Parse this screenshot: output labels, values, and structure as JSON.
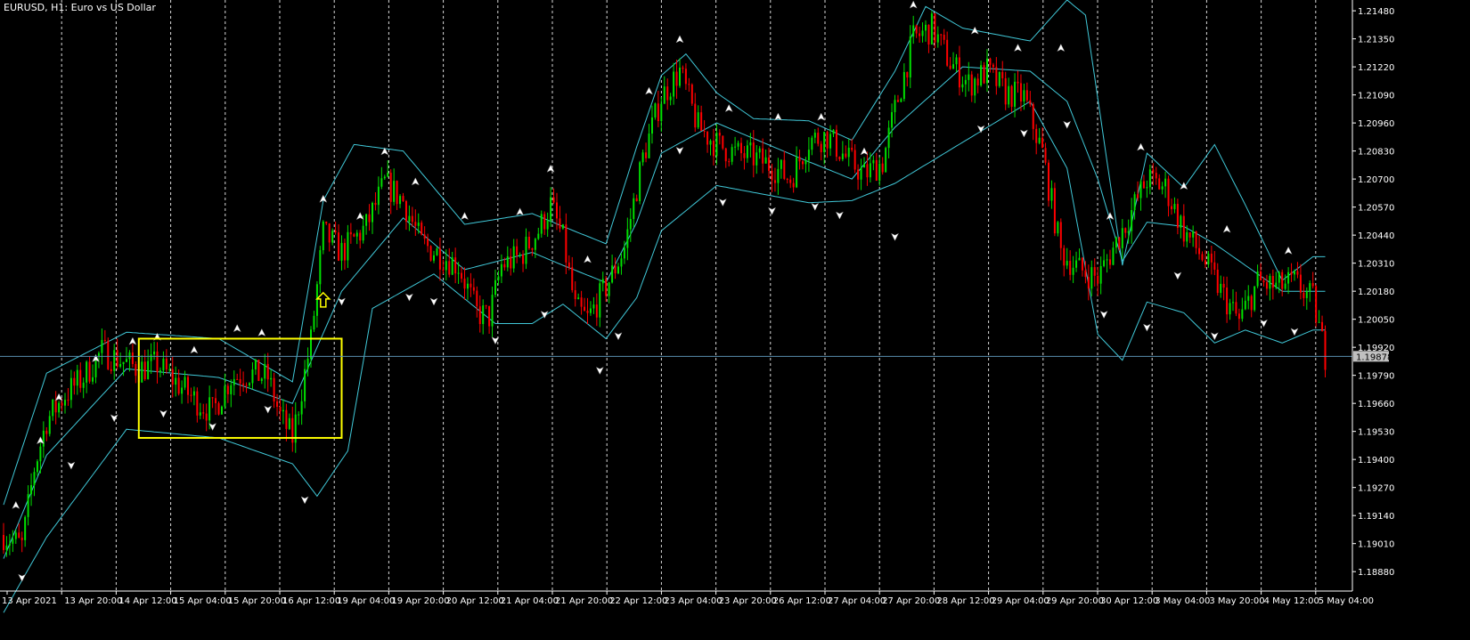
{
  "window": {
    "title": "EURUSD, H1:  Euro vs US Dollar"
  },
  "colors": {
    "background": "#000000",
    "bull": "#00e000",
    "bear": "#ff0000",
    "bands": "#40c8d8",
    "grid": "#ffffff",
    "axis": "#ffffff",
    "price_line": "#5a8fb0",
    "price_tag": "#c0c0c0",
    "annotation": "#ffff00",
    "fractal": "#ffffff"
  },
  "chart_data": {
    "type": "candlestick",
    "symbol": "EURUSD",
    "timeframe": "H1",
    "description": "Euro vs US Dollar",
    "ylim": [
      1.1879,
      1.2153
    ],
    "y_ticks": [
      "1.21480",
      "1.21350",
      "1.21220",
      "1.21090",
      "1.20960",
      "1.20830",
      "1.20700",
      "1.20570",
      "1.20440",
      "1.20310",
      "1.20180",
      "1.20050",
      "1.19920",
      "1.19790",
      "1.19660",
      "1.19530",
      "1.19400",
      "1.19270",
      "1.19140",
      "1.19010",
      "1.18880"
    ],
    "current_price": "1.19878",
    "x_ticks": [
      "13 Apr 2021",
      "13 Apr 20:00",
      "14 Apr 12:00",
      "15 Apr 04:00",
      "15 Apr 20:00",
      "16 Apr 12:00",
      "19 Apr 04:00",
      "19 Apr 20:00",
      "20 Apr 12:00",
      "21 Apr 04:00",
      "21 Apr 20:00",
      "22 Apr 12:00",
      "23 Apr 04:00",
      "23 Apr 20:00",
      "26 Apr 12:00",
      "27 Apr 04:00",
      "27 Apr 20:00",
      "28 Apr 12:00",
      "29 Apr 04:00",
      "29 Apr 20:00",
      "30 Apr 12:00",
      "3 May 04:00",
      "3 May 20:00",
      "4 May 12:00",
      "5 May 04:00"
    ],
    "grid": "vertical-dashed",
    "indicators": [
      "Bollinger Bands",
      "Fractals"
    ],
    "close_path": [
      [
        0,
        1.1905
      ],
      [
        6,
        1.19
      ],
      [
        10,
        1.1936
      ],
      [
        14,
        1.1958
      ],
      [
        20,
        1.197
      ],
      [
        26,
        1.1978
      ],
      [
        32,
        1.199
      ],
      [
        38,
        1.1986
      ],
      [
        44,
        1.1982
      ],
      [
        50,
        1.1984
      ],
      [
        56,
        1.1976
      ],
      [
        62,
        1.1968
      ],
      [
        68,
        1.1962
      ],
      [
        74,
        1.1978
      ],
      [
        80,
        1.198
      ],
      [
        86,
        1.1978
      ],
      [
        90,
        1.196
      ],
      [
        94,
        1.195
      ],
      [
        100,
        1.1995
      ],
      [
        104,
        1.2045
      ],
      [
        110,
        1.2036
      ],
      [
        118,
        1.2048
      ],
      [
        124,
        1.2068
      ],
      [
        130,
        1.206
      ],
      [
        136,
        1.204
      ],
      [
        142,
        1.2035
      ],
      [
        148,
        1.203
      ],
      [
        154,
        1.2008
      ],
      [
        158,
        1.2006
      ],
      [
        162,
        1.203
      ],
      [
        168,
        1.2034
      ],
      [
        174,
        1.2046
      ],
      [
        178,
        1.2058
      ],
      [
        182,
        1.2042
      ],
      [
        186,
        1.201
      ],
      [
        190,
        1.2005
      ],
      [
        196,
        1.202
      ],
      [
        202,
        1.2038
      ],
      [
        208,
        1.208
      ],
      [
        214,
        1.2108
      ],
      [
        220,
        1.212
      ],
      [
        226,
        1.2094
      ],
      [
        232,
        1.2086
      ],
      [
        238,
        1.2082
      ],
      [
        244,
        1.208
      ],
      [
        250,
        1.2076
      ],
      [
        256,
        1.207
      ],
      [
        262,
        1.2088
      ],
      [
        268,
        1.209
      ],
      [
        274,
        1.208
      ],
      [
        280,
        1.2072
      ],
      [
        286,
        1.2078
      ],
      [
        290,
        1.2102
      ],
      [
        296,
        1.2135
      ],
      [
        302,
        1.214
      ],
      [
        308,
        1.2124
      ],
      [
        314,
        1.2114
      ],
      [
        320,
        1.212
      ],
      [
        326,
        1.211
      ],
      [
        332,
        1.2108
      ],
      [
        338,
        1.2082
      ],
      [
        344,
        1.2036
      ],
      [
        350,
        1.2028
      ],
      [
        356,
        1.2024
      ],
      [
        360,
        1.2035
      ],
      [
        366,
        1.2052
      ],
      [
        372,
        1.207
      ],
      [
        378,
        1.2066
      ],
      [
        384,
        1.2046
      ],
      [
        390,
        1.2034
      ],
      [
        396,
        1.2018
      ],
      [
        402,
        1.2004
      ],
      [
        408,
        1.2022
      ],
      [
        414,
        1.202
      ],
      [
        420,
        1.2022
      ],
      [
        426,
        1.2014
      ],
      [
        430,
        1.1988
      ]
    ],
    "bands_upper": [
      [
        0,
        1.1919
      ],
      [
        14,
        1.198
      ],
      [
        40,
        1.1999
      ],
      [
        70,
        1.1996
      ],
      [
        94,
        1.1976
      ],
      [
        104,
        1.206
      ],
      [
        114,
        1.2086
      ],
      [
        130,
        1.2083
      ],
      [
        150,
        1.2049
      ],
      [
        172,
        1.2054
      ],
      [
        182,
        1.2048
      ],
      [
        196,
        1.204
      ],
      [
        206,
        1.2085
      ],
      [
        214,
        1.2118
      ],
      [
        222,
        1.2128
      ],
      [
        232,
        1.211
      ],
      [
        244,
        1.2098
      ],
      [
        262,
        1.2097
      ],
      [
        276,
        1.2088
      ],
      [
        290,
        1.212
      ],
      [
        300,
        1.215
      ],
      [
        312,
        1.214
      ],
      [
        334,
        1.2134
      ],
      [
        346,
        1.2153
      ],
      [
        352,
        1.2146
      ],
      [
        364,
        1.203
      ],
      [
        372,
        1.2082
      ],
      [
        384,
        1.2066
      ],
      [
        394,
        1.2086
      ],
      [
        404,
        1.2058
      ],
      [
        416,
        1.2023
      ],
      [
        426,
        1.2034
      ]
    ],
    "bands_middle": [
      [
        0,
        1.1894
      ],
      [
        14,
        1.1942
      ],
      [
        40,
        1.1982
      ],
      [
        70,
        1.1978
      ],
      [
        94,
        1.1966
      ],
      [
        110,
        1.2018
      ],
      [
        130,
        1.2052
      ],
      [
        150,
        1.2028
      ],
      [
        172,
        1.2036
      ],
      [
        182,
        1.203
      ],
      [
        196,
        1.2022
      ],
      [
        206,
        1.205
      ],
      [
        214,
        1.2082
      ],
      [
        232,
        1.2096
      ],
      [
        262,
        1.2078
      ],
      [
        276,
        1.207
      ],
      [
        290,
        1.2094
      ],
      [
        312,
        1.2122
      ],
      [
        334,
        1.212
      ],
      [
        346,
        1.2106
      ],
      [
        356,
        1.207
      ],
      [
        364,
        1.2032
      ],
      [
        372,
        1.205
      ],
      [
        384,
        1.2048
      ],
      [
        394,
        1.204
      ],
      [
        404,
        1.203
      ],
      [
        416,
        1.2018
      ],
      [
        426,
        1.2018
      ]
    ],
    "bands_lower": [
      [
        0,
        1.1869
      ],
      [
        14,
        1.1904
      ],
      [
        40,
        1.1954
      ],
      [
        70,
        1.195
      ],
      [
        94,
        1.1938
      ],
      [
        102,
        1.1923
      ],
      [
        112,
        1.1944
      ],
      [
        120,
        1.201
      ],
      [
        140,
        1.2026
      ],
      [
        160,
        1.2003
      ],
      [
        172,
        1.2003
      ],
      [
        182,
        1.2012
      ],
      [
        196,
        1.1996
      ],
      [
        206,
        1.2015
      ],
      [
        214,
        1.2046
      ],
      [
        232,
        1.2067
      ],
      [
        262,
        1.2059
      ],
      [
        276,
        1.206
      ],
      [
        290,
        1.2068
      ],
      [
        312,
        1.2087
      ],
      [
        334,
        1.2106
      ],
      [
        346,
        1.2075
      ],
      [
        356,
        1.1998
      ],
      [
        364,
        1.1986
      ],
      [
        372,
        1.2013
      ],
      [
        384,
        1.2008
      ],
      [
        394,
        1.1994
      ],
      [
        404,
        1.2
      ],
      [
        416,
        1.1994
      ],
      [
        426,
        1.2
      ]
    ],
    "fractals_up": [
      [
        4,
        1.1916
      ],
      [
        12,
        1.1946
      ],
      [
        18,
        1.1966
      ],
      [
        30,
        1.1984
      ],
      [
        42,
        1.1992
      ],
      [
        50,
        1.1994
      ],
      [
        62,
        1.1988
      ],
      [
        76,
        1.1998
      ],
      [
        84,
        1.1996
      ],
      [
        104,
        1.2058
      ],
      [
        116,
        1.205
      ],
      [
        124,
        1.208
      ],
      [
        134,
        1.2066
      ],
      [
        150,
        1.205
      ],
      [
        168,
        1.2052
      ],
      [
        178,
        1.2072
      ],
      [
        190,
        1.203
      ],
      [
        210,
        1.2108
      ],
      [
        220,
        1.2132
      ],
      [
        236,
        1.21
      ],
      [
        252,
        1.2096
      ],
      [
        266,
        1.2096
      ],
      [
        280,
        1.208
      ],
      [
        296,
        1.2148
      ],
      [
        304,
        1.2153
      ],
      [
        316,
        1.2136
      ],
      [
        330,
        1.2128
      ],
      [
        344,
        1.2128
      ],
      [
        360,
        1.205
      ],
      [
        370,
        1.2082
      ],
      [
        384,
        1.2064
      ],
      [
        398,
        1.2044
      ],
      [
        418,
        1.2034
      ]
    ],
    "fractals_down": [
      [
        6,
        1.1888
      ],
      [
        22,
        1.194
      ],
      [
        36,
        1.1962
      ],
      [
        52,
        1.1964
      ],
      [
        68,
        1.1958
      ],
      [
        86,
        1.1966
      ],
      [
        98,
        1.1924
      ],
      [
        110,
        1.2016
      ],
      [
        132,
        1.2018
      ],
      [
        140,
        1.2016
      ],
      [
        160,
        1.1998
      ],
      [
        176,
        1.201
      ],
      [
        194,
        1.1984
      ],
      [
        200,
        1.2
      ],
      [
        220,
        1.2086
      ],
      [
        234,
        1.2062
      ],
      [
        250,
        1.2058
      ],
      [
        264,
        1.206
      ],
      [
        272,
        1.2056
      ],
      [
        290,
        1.2046
      ],
      [
        318,
        1.2096
      ],
      [
        332,
        1.2094
      ],
      [
        346,
        1.2098
      ],
      [
        358,
        1.201
      ],
      [
        372,
        1.2004
      ],
      [
        382,
        1.2028
      ],
      [
        394,
        1.2
      ],
      [
        410,
        1.2006
      ],
      [
        420,
        1.2002
      ]
    ],
    "annotations": {
      "rectangle": {
        "x": [
          44,
          110
        ],
        "y": [
          1.195,
          1.1996
        ]
      },
      "arrow_up": {
        "x": 104,
        "y": 1.2014
      }
    }
  }
}
